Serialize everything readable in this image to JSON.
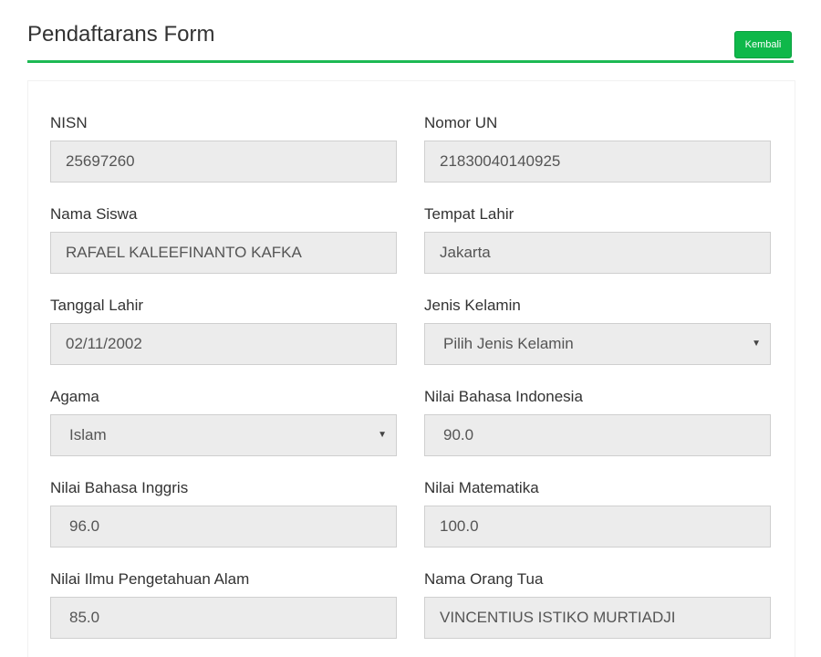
{
  "header": {
    "title": "Pendaftarans Form",
    "back_label": "Kembali"
  },
  "colors": {
    "accent": "#1db954",
    "button": "#0fb84a",
    "field_bg": "#ececec"
  },
  "form": {
    "nisn": {
      "label": "NISN",
      "value": "25697260"
    },
    "nomor_un": {
      "label": "Nomor UN",
      "value": "21830040140925"
    },
    "nama_siswa": {
      "label": "Nama Siswa",
      "value": "RAFAEL KALEEFINANTO KAFKA"
    },
    "tempat_lahir": {
      "label": "Tempat Lahir",
      "value": "Jakarta"
    },
    "tanggal_lahir": {
      "label": "Tanggal Lahir",
      "value": "02/11/2002"
    },
    "jenis_kelamin": {
      "label": "Jenis Kelamin",
      "value": "Pilih Jenis Kelamin"
    },
    "agama": {
      "label": "Agama",
      "value": "Islam"
    },
    "nilai_bahasa_indonesia": {
      "label": "Nilai Bahasa Indonesia",
      "value": "90.0"
    },
    "nilai_bahasa_inggris": {
      "label": "Nilai Bahasa Inggris",
      "value": "96.0"
    },
    "nilai_matematika": {
      "label": "Nilai Matematika",
      "value": "100.0"
    },
    "nilai_ipa": {
      "label": "Nilai Ilmu Pengetahuan Alam",
      "value": "85.0"
    },
    "nama_orang_tua": {
      "label": "Nama Orang Tua",
      "value": "VINCENTIUS ISTIKO MURTIADJI"
    }
  },
  "icons": {
    "select_caret": "chevron-down-icon"
  }
}
